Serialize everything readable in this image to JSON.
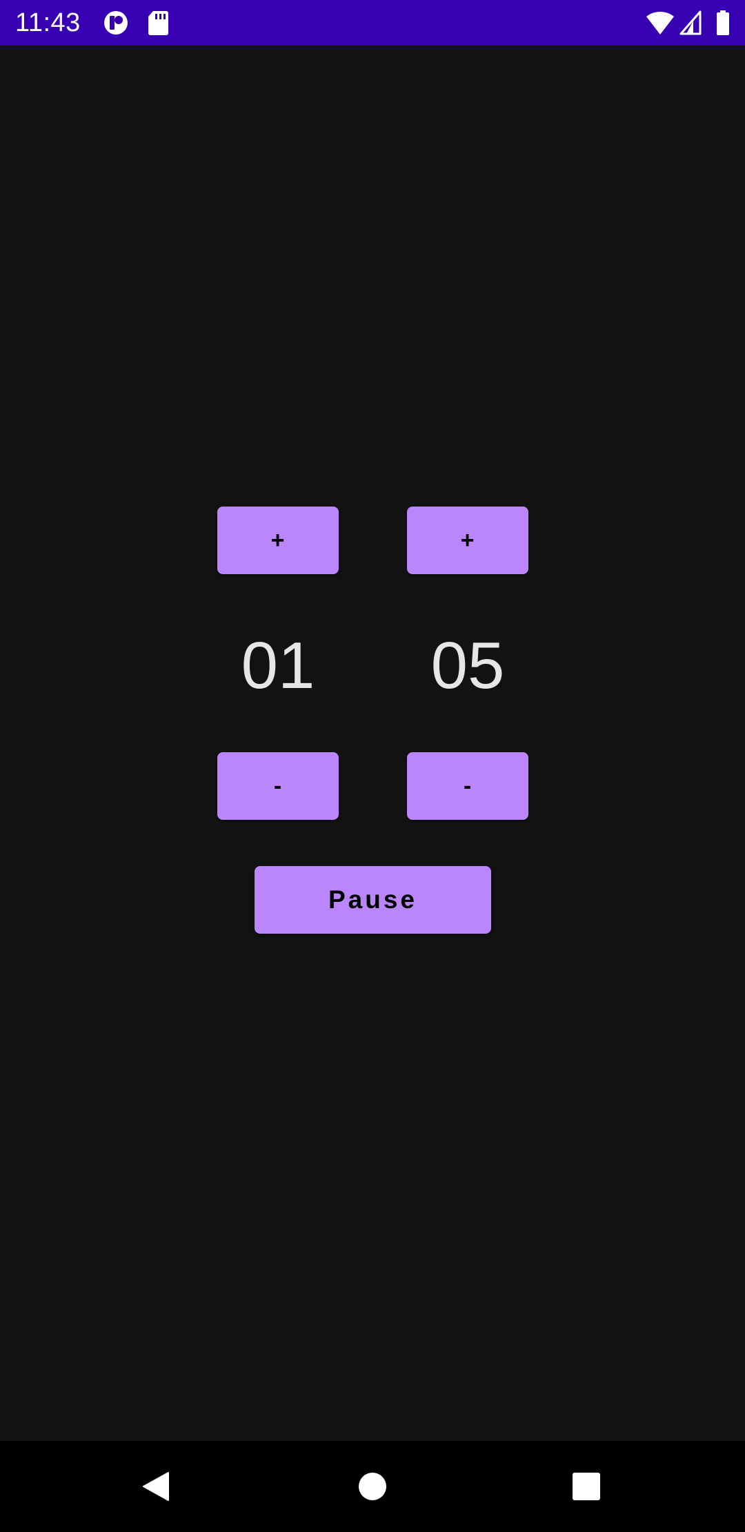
{
  "status_bar": {
    "time": "11:43",
    "background": "#3700b3",
    "icons": [
      "app-notification-icon",
      "sd-card-icon",
      "wifi-icon",
      "signal-icon",
      "battery-icon"
    ]
  },
  "timer": {
    "minutes": "01",
    "seconds": "05",
    "minutes_plus_label": "+",
    "minutes_minus_label": "-",
    "seconds_plus_label": "+",
    "seconds_minus_label": "-",
    "pause_label": "Pause"
  },
  "colors": {
    "background": "#121212",
    "accent": "#bb86fc",
    "text": "#e6e6e6"
  },
  "nav_bar": {
    "icons": [
      "back-icon",
      "home-icon",
      "recents-icon"
    ]
  }
}
